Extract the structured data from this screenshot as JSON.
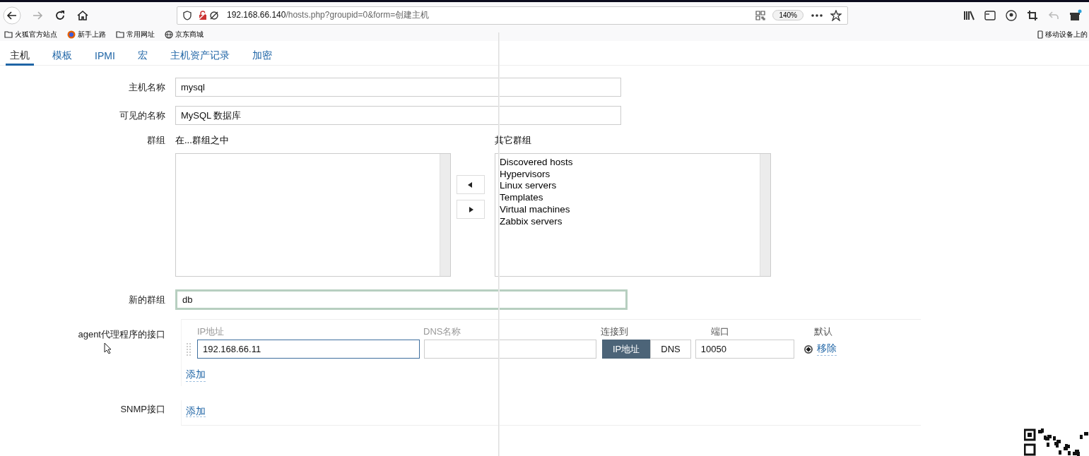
{
  "browser": {
    "url_host": "192.168.66.140",
    "url_path": "/hosts.php?groupid=0&form=创建主机",
    "zoom": "140%",
    "bookmarks": [
      {
        "label": "火狐官方站点",
        "kind": "folder"
      },
      {
        "label": "新手上路",
        "kind": "firefox"
      },
      {
        "label": "常用网址",
        "kind": "folder"
      },
      {
        "label": "京东商城",
        "kind": "globe"
      }
    ],
    "mobile_bookmarks": "移动设备上的"
  },
  "tabs": [
    {
      "label": "主机",
      "selected": true
    },
    {
      "label": "模板",
      "selected": false
    },
    {
      "label": "IPMI",
      "selected": false
    },
    {
      "label": "宏",
      "selected": false
    },
    {
      "label": "主机资产记录",
      "selected": false
    },
    {
      "label": "加密",
      "selected": false
    }
  ],
  "form": {
    "host_name": {
      "label": "主机名称",
      "value": "mysql"
    },
    "visible_name": {
      "label": "可见的名称",
      "value": "MySQL 数据库"
    },
    "groups": {
      "label": "群组",
      "in_title": "在...群组之中",
      "other_title": "其它群组",
      "other_groups": [
        "Discovered hosts",
        "Hypervisors",
        "Linux servers",
        "Templates",
        "Virtual machines",
        "Zabbix servers"
      ]
    },
    "new_group": {
      "label": "新的群组",
      "value": "db"
    },
    "agent_interfaces": {
      "label": "agent代理程序的接口",
      "columns": [
        "IP地址",
        "DNS名称",
        "连接到",
        "端口",
        "默认"
      ],
      "rows": [
        {
          "ip": "192.168.66.11",
          "dns": "",
          "connect": [
            {
              "label": "IP地址",
              "selected": true
            },
            {
              "label": "DNS",
              "selected": false
            }
          ],
          "port": "10050",
          "default": true,
          "remove": "移除"
        }
      ],
      "add": "添加"
    },
    "snmp_interfaces": {
      "label": "SNMP接口",
      "add": "添加"
    }
  }
}
